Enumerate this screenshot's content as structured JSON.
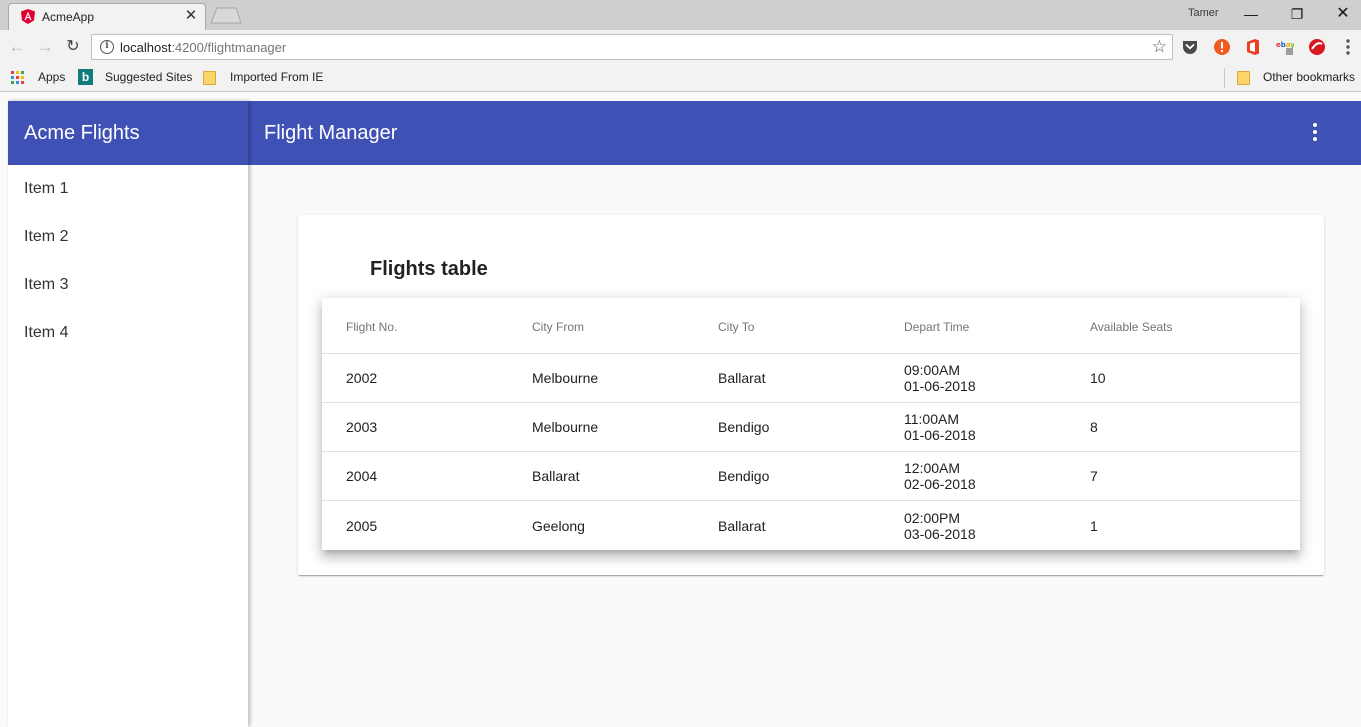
{
  "browser": {
    "tab_title": "AcmeApp",
    "tab_close": "✕",
    "profile_name": "Tamer",
    "url_host": "localhost",
    "url_path": ":4200/flightmanager",
    "bookmarks": {
      "apps": "Apps",
      "suggested": "Suggested Sites",
      "imported": "Imported From IE",
      "other": "Other bookmarks"
    }
  },
  "sidenav": {
    "title": "Acme Flights",
    "items": [
      "Item 1",
      "Item 2",
      "Item 3",
      "Item 4"
    ]
  },
  "toolbar": {
    "title": "Flight Manager"
  },
  "card": {
    "title": "Flights table",
    "columns": [
      "Flight No.",
      "City From",
      "City To",
      "Depart Time",
      "Available Seats"
    ],
    "rows": [
      {
        "flight_no": "2002",
        "city_from": "Melbourne",
        "city_to": "Ballarat",
        "time": "09:00AM",
        "date": "01-06-2018",
        "seats": "10"
      },
      {
        "flight_no": "2003",
        "city_from": "Melbourne",
        "city_to": "Bendigo",
        "time": "11:00AM",
        "date": "01-06-2018",
        "seats": "8"
      },
      {
        "flight_no": "2004",
        "city_from": "Ballarat",
        "city_to": "Bendigo",
        "time": "12:00AM",
        "date": "02-06-2018",
        "seats": "7"
      },
      {
        "flight_no": "2005",
        "city_from": "Geelong",
        "city_to": "Ballarat",
        "time": "02:00PM",
        "date": "03-06-2018",
        "seats": "1"
      }
    ]
  },
  "colors": {
    "primary": "#3f51b5",
    "background": "#fafafa"
  }
}
